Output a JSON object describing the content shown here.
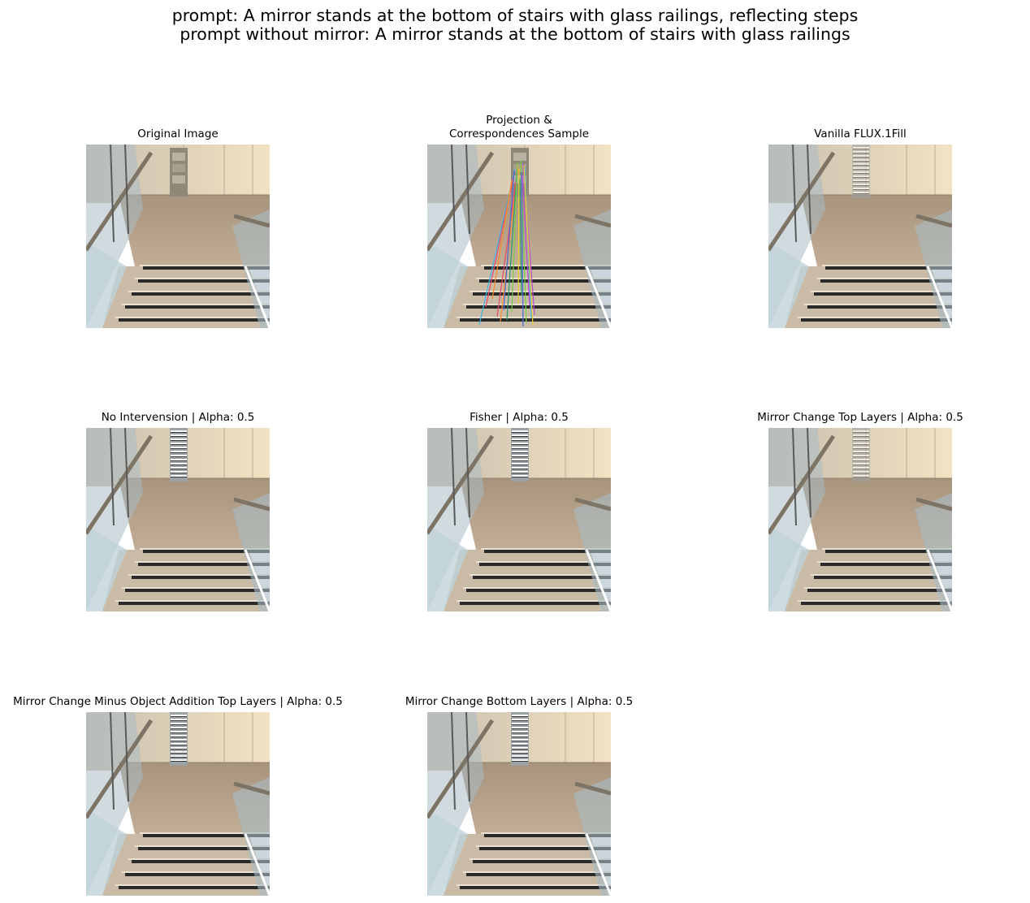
{
  "figure": {
    "title_line1": "prompt: A mirror stands at the bottom of stairs with glass railings, reflecting steps",
    "title_line2": "prompt without mirror: A mirror stands at the bottom of stairs with glass railings"
  },
  "panels": [
    {
      "title": "Original Image",
      "mirror": "cabinet"
    },
    {
      "title_line1": "Projection &",
      "title_line2": "Correspondences Sample",
      "mirror": "cabinet",
      "correspondences": true
    },
    {
      "title": "Vanilla FLUX.1Fill",
      "mirror": "stairs-faint"
    },
    {
      "title": "No Intervension | Alpha: 0.5",
      "mirror": "stairs"
    },
    {
      "title": "Fisher | Alpha: 0.5",
      "mirror": "stairs"
    },
    {
      "title": "Mirror Change Top Layers | Alpha: 0.5",
      "mirror": "stairs-faint"
    },
    {
      "title": "Mirror Change Minus Object Addition Top Layers | Alpha: 0.5",
      "mirror": "stairs"
    },
    {
      "title": "Mirror Change Bottom Layers | Alpha: 0.5",
      "mirror": "stairs"
    }
  ],
  "colors": {
    "wall": "#e9dcc4",
    "floor": "#b59f86",
    "step": "#c9bba6",
    "nosing": "#2a2a2a",
    "glass": "#a9bcc4",
    "rail": "#7d7466",
    "correspondence_lines": [
      "#3fb4e6",
      "#ff8c2a",
      "#7ad04a",
      "#b84ad8",
      "#e84a6a",
      "#2a9a6a",
      "#f0d030",
      "#4a6ad8"
    ]
  }
}
